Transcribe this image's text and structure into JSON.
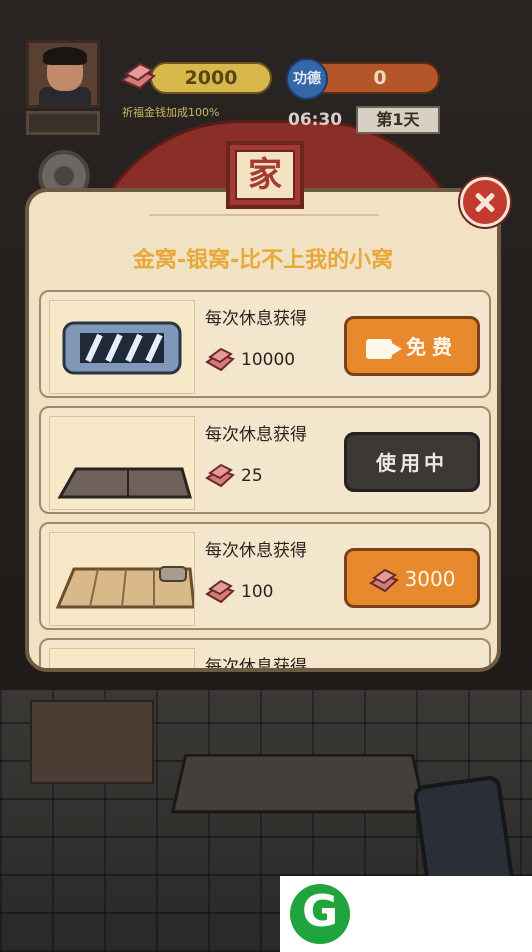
{
  "hud": {
    "money": "2000",
    "bonus_text": "祈福金钱加成100%",
    "merit_label": "功德",
    "merit_value": "0",
    "time": "06:30",
    "day": "第1天"
  },
  "dialog": {
    "title": "家",
    "subtitle": "金窝-银窝-比不上我的小窝",
    "items": [
      {
        "label": "每次休息获得",
        "reward": "10000",
        "button": "免费",
        "button_style": "orange-video"
      },
      {
        "label": "每次休息获得",
        "reward": "25",
        "button": "使用中",
        "button_style": "dark"
      },
      {
        "label": "每次休息获得",
        "reward": "100",
        "button": "3000",
        "button_style": "orange-money"
      },
      {
        "label": "每次休息获得"
      }
    ]
  },
  "colors": {
    "accent_orange": "#e8892e",
    "title_red": "#a33b30",
    "subtitle_gold": "#e8a83a",
    "dialog_bg": "#f1e2c4"
  },
  "icons": [
    "money-icon",
    "gear-icon",
    "close-icon",
    "video-icon",
    "avatar"
  ]
}
